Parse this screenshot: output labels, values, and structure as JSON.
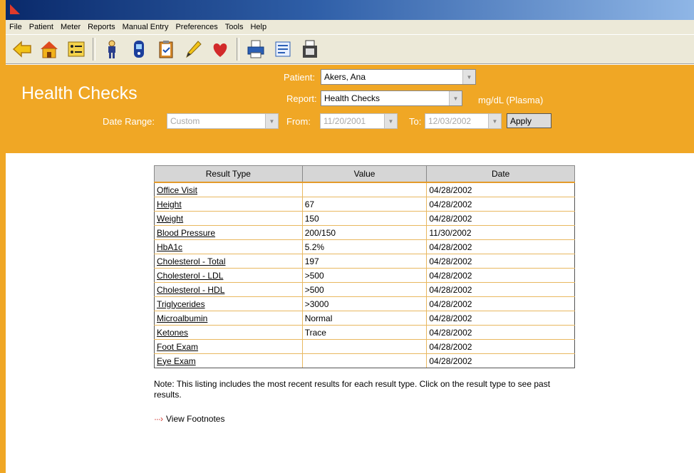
{
  "menu": [
    "File",
    "Patient",
    "Meter",
    "Reports",
    "Manual Entry",
    "Preferences",
    "Tools",
    "Help"
  ],
  "toolbar": {
    "icons": [
      "back-arrow-icon",
      "home-icon",
      "patient-list-icon",
      "person-icon",
      "meter-icon",
      "clipboard-icon",
      "pencil-icon",
      "heart-icon",
      "printer-icon",
      "report-icon",
      "fax-icon"
    ]
  },
  "colors": {
    "header": "#f0a725",
    "titlebar": "#0a2a6b",
    "heart": "#d22a2a"
  },
  "header": {
    "title": "Health Checks",
    "patient_label": "Patient:",
    "patient_value": "Akers, Ana",
    "report_label": "Report:",
    "report_value": "Health Checks",
    "units": "mg/dL (Plasma)",
    "date_range_label": "Date Range:",
    "date_range_value": "Custom",
    "from_label": "From:",
    "from_value": "11/20/2001",
    "to_label": "To:",
    "to_value": "12/03/2002",
    "apply_label": "Apply"
  },
  "table": {
    "columns": [
      "Result Type",
      "Value",
      "Date"
    ],
    "rows": [
      {
        "type": "Office Visit",
        "value": "",
        "date": "04/28/2002"
      },
      {
        "type": "Height",
        "value": "67",
        "date": "04/28/2002"
      },
      {
        "type": "Weight",
        "value": "150",
        "date": "04/28/2002"
      },
      {
        "type": "Blood Pressure",
        "value": "200/150",
        "date": "11/30/2002"
      },
      {
        "type": "HbA1c",
        "value": "5.2%",
        "date": "04/28/2002"
      },
      {
        "type": "Cholesterol - Total",
        "value": "197",
        "date": "04/28/2002"
      },
      {
        "type": "Cholesterol - LDL",
        "value": ">500",
        "date": "04/28/2002"
      },
      {
        "type": "Cholesterol - HDL",
        "value": ">500",
        "date": "04/28/2002"
      },
      {
        "type": "Triglycerides",
        "value": ">3000",
        "date": "04/28/2002"
      },
      {
        "type": "Microalbumin",
        "value": "Normal",
        "date": "04/28/2002"
      },
      {
        "type": "Ketones",
        "value": "Trace",
        "date": "04/28/2002"
      },
      {
        "type": "Foot Exam",
        "value": "",
        "date": "04/28/2002"
      },
      {
        "type": "Eye Exam",
        "value": "",
        "date": "04/28/2002"
      }
    ]
  },
  "note": "Note: This listing includes the most recent results for each result type. Click on the result type to see past results.",
  "footnotes_link": "View Footnotes"
}
